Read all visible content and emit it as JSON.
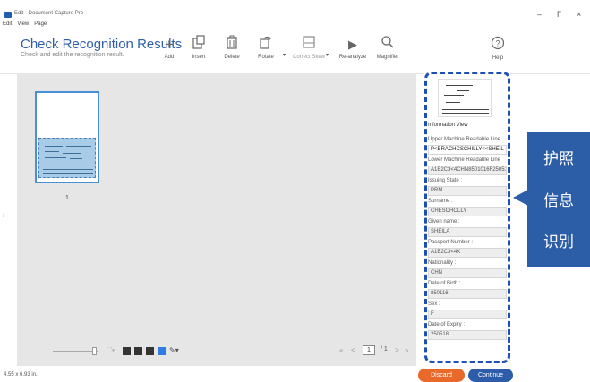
{
  "window": {
    "title": "Edit - Document Capture Pro",
    "controls": {
      "minimize": "–",
      "maximize": "Г",
      "close": "×"
    }
  },
  "menu": [
    "Edit",
    "View",
    "Page"
  ],
  "header": {
    "title": "Check Recognition Results",
    "subtitle": "Check and edit the recognition result."
  },
  "tools": [
    {
      "label": "Add",
      "icon": "plus-icon"
    },
    {
      "label": "Insert",
      "icon": "insert-icon"
    },
    {
      "label": "Delete",
      "icon": "trash-icon"
    },
    {
      "label": "Rotate",
      "icon": "rotate-icon"
    },
    {
      "label": "Correct Skew",
      "icon": "correct-skew-icon"
    },
    {
      "label": "Re-analyze",
      "icon": "play-icon"
    },
    {
      "label": "Magnifier",
      "icon": "magnifier-icon"
    }
  ],
  "help": {
    "label": "Help",
    "icon": "help-icon"
  },
  "thumbnails": {
    "page_number": "1"
  },
  "pagination": {
    "current": "1",
    "total": "/ 1",
    "first": "«",
    "prev": "<",
    "next": ">",
    "last": "»"
  },
  "status": {
    "page_size": "4.55 x 6.93 in."
  },
  "buttons": {
    "discard": "Discard",
    "continue": "Continue"
  },
  "panel": {
    "section_title": "Information View",
    "fields": [
      {
        "label": "Upper Machine Readable Line",
        "value": "P<BRACHCSCHILLY<<SHEIL",
        "editable": true
      },
      {
        "label": "Lower Machine Readable Line",
        "value": "A1B2C3<4CHN8501016F2505189",
        "editable": false
      },
      {
        "label": "Issuing State :",
        "value": "PRM",
        "editable": false
      },
      {
        "label": "Surname :",
        "value": "CHESCHOLLY",
        "editable": false
      },
      {
        "label": "Given name :",
        "value": "SHEILA",
        "editable": false
      },
      {
        "label": "Passport Number :",
        "value": "A1B2C3<4K",
        "editable": false
      },
      {
        "label": "Nationality :",
        "value": "CHN",
        "editable": false
      },
      {
        "label": "Date of Birth :",
        "value": "850116",
        "editable": false
      },
      {
        "label": "Sex :",
        "value": "F",
        "editable": false
      },
      {
        "label": "Date of Expiry :",
        "value": "250518",
        "editable": false
      }
    ]
  },
  "callout": {
    "lines": [
      "护照",
      "信息",
      "识别"
    ]
  },
  "colors": {
    "accent": "#2e5fa8",
    "callout": "#2c5da7",
    "discard": "#e8692a",
    "continue": "#2d5ca8",
    "highlight": "#1e4fb5"
  }
}
